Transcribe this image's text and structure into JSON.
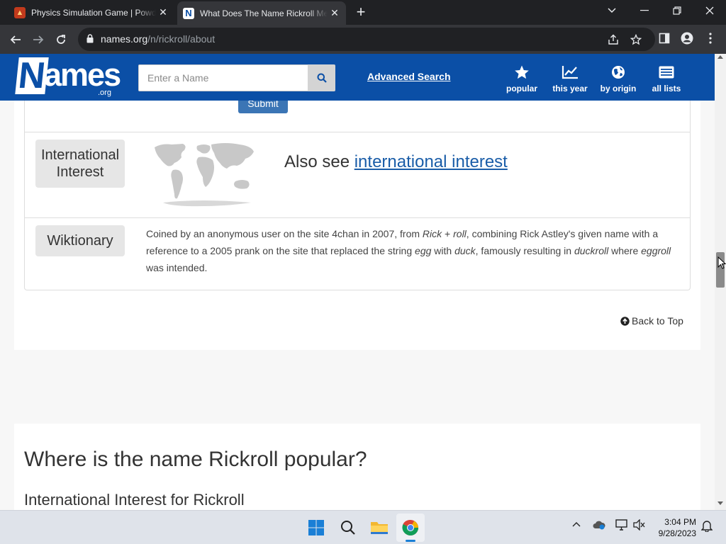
{
  "browser": {
    "tabs": [
      {
        "title": "Physics Simulation Game | Powder",
        "active": false
      },
      {
        "title": "What Does The Name Rickroll Mean",
        "active": true
      }
    ],
    "url_host": "names.org",
    "url_path": "/n/rickroll/about"
  },
  "site": {
    "logo_main": "Names",
    "logo_sub": ".org",
    "search_placeholder": "Enter a Name",
    "advanced_search": "Advanced Search",
    "nav": [
      {
        "label": "popular",
        "icon": "star-icon"
      },
      {
        "label": "this year",
        "icon": "chart-line-icon"
      },
      {
        "label": "by origin",
        "icon": "globe-icon"
      },
      {
        "label": "all lists",
        "icon": "list-icon"
      }
    ]
  },
  "content": {
    "submit_label": "Submit",
    "intl_label_line1": "International",
    "intl_label_line2": "Interest",
    "also_see_prefix": "Also see ",
    "also_see_link": "international interest",
    "wiktionary_label": "Wiktionary",
    "wiktionary_parts": {
      "p1": "Coined by an anonymous user on the site 4chan in 2007, from ",
      "i1": "Rick",
      "p2": " + ",
      "i2": "roll",
      "p3": ", combining Rick Astley's given name with a reference to a 2005 prank on the site that replaced the string ",
      "i3": "egg",
      "p4": " with ",
      "i4": "duck",
      "p5": ", famously resulting in ",
      "i5": "duckroll",
      "p6": " where ",
      "i6": "eggroll",
      "p7": " was intended."
    },
    "back_to_top": "Back to Top",
    "heading_popular": "Where is the name Rickroll popular?",
    "heading_international": "International Interest for Rickroll"
  },
  "taskbar": {
    "time": "3:04 PM",
    "date": "9/28/2023"
  },
  "colors": {
    "brand_blue": "#0b4fa6",
    "link_blue": "#1a5da8"
  }
}
